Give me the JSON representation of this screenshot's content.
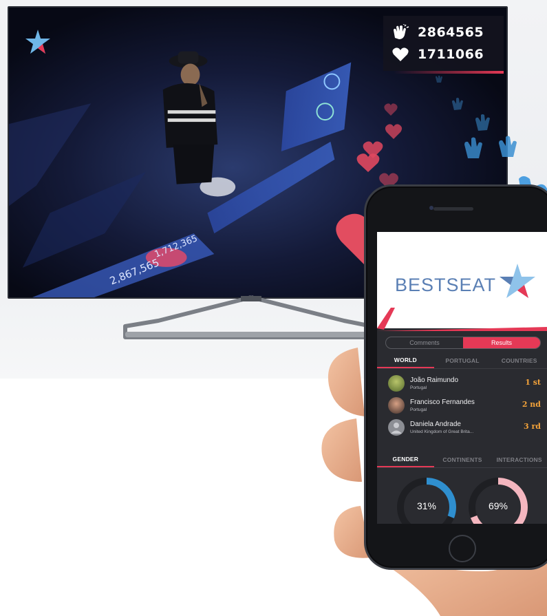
{
  "tv": {
    "claps_count": "2864565",
    "likes_count": "1711066",
    "icons": {
      "claps": "clapping-hands-icon",
      "likes": "heart-icon",
      "logo": "star-logo-icon"
    }
  },
  "app": {
    "brand": "BESTSEAT",
    "toggle": [
      {
        "label": "Comments",
        "active": false
      },
      {
        "label": "Results",
        "active": true
      }
    ],
    "region_tabs": [
      {
        "label": "WORLD",
        "active": true
      },
      {
        "label": "PORTUGAL",
        "active": false
      },
      {
        "label": "COUNTRIES",
        "active": false
      }
    ],
    "ranking": [
      {
        "name": "João Raimundo",
        "country": "Portugal",
        "place": "1 st"
      },
      {
        "name": "Francisco Fernandes",
        "country": "Portugal",
        "place": "2 nd"
      },
      {
        "name": "Daniela Andrade",
        "country": "United Kingdom of Great Brita...",
        "place": "3 rd"
      }
    ],
    "stat_tabs": [
      {
        "label": "GENDER",
        "active": true
      },
      {
        "label": "CONTINENTS",
        "active": false
      },
      {
        "label": "INTERACTIONS",
        "active": false
      }
    ],
    "gender": [
      {
        "value_label": "31%",
        "percent": 31,
        "color": "#2f8fcf"
      },
      {
        "value_label": "69%",
        "percent": 69,
        "color": "#f4b6bf"
      }
    ]
  },
  "colors": {
    "accent": "#e53956",
    "rank": "#f2a23a",
    "brand": "#5a7fb4"
  }
}
